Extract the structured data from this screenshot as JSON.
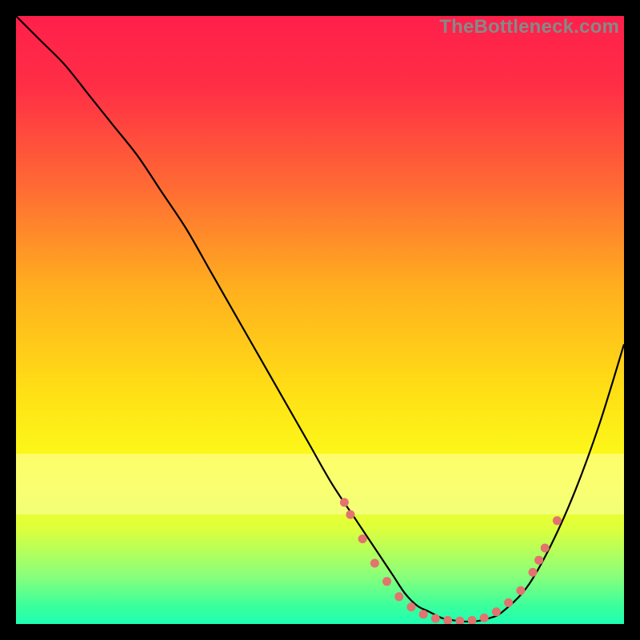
{
  "watermark": "TheBottleneck.com",
  "chart_data": {
    "type": "line",
    "title": "",
    "xlabel": "",
    "ylabel": "",
    "xlim": [
      0,
      100
    ],
    "ylim": [
      0,
      100
    ],
    "gradient_stops": [
      {
        "offset": 0.0,
        "color": "#ff1f4b"
      },
      {
        "offset": 0.12,
        "color": "#ff2f45"
      },
      {
        "offset": 0.28,
        "color": "#ff6a34"
      },
      {
        "offset": 0.45,
        "color": "#ffb01e"
      },
      {
        "offset": 0.62,
        "color": "#ffe015"
      },
      {
        "offset": 0.75,
        "color": "#fbff1a"
      },
      {
        "offset": 0.84,
        "color": "#e0ff3a"
      },
      {
        "offset": 0.92,
        "color": "#8bff7a"
      },
      {
        "offset": 0.97,
        "color": "#3bff9c"
      },
      {
        "offset": 1.0,
        "color": "#1dffb2"
      }
    ],
    "pale_band": {
      "y1": 72,
      "y2": 82,
      "color": "#feffb0",
      "opacity": 0.55
    },
    "series": [
      {
        "name": "curve",
        "x": [
          0,
          4,
          8,
          12,
          16,
          20,
          24,
          28,
          32,
          36,
          40,
          44,
          48,
          52,
          56,
          58,
          60,
          62,
          64,
          66,
          68,
          70,
          72,
          74,
          76,
          78,
          80,
          84,
          88,
          92,
          96,
          100
        ],
        "y": [
          100,
          96,
          92,
          87,
          82,
          77,
          71,
          65,
          58,
          51,
          44,
          37,
          30,
          23,
          17,
          14,
          11,
          8,
          5,
          3,
          2,
          1,
          0.6,
          0.4,
          0.5,
          1,
          2,
          6,
          13,
          22,
          33,
          46
        ]
      }
    ],
    "markers": {
      "name": "dotted-region",
      "color": "#e2736f",
      "radius": 5.5,
      "points": [
        {
          "x": 54,
          "y": 20
        },
        {
          "x": 55,
          "y": 18
        },
        {
          "x": 57,
          "y": 14
        },
        {
          "x": 59,
          "y": 10
        },
        {
          "x": 61,
          "y": 7
        },
        {
          "x": 63,
          "y": 4.5
        },
        {
          "x": 65,
          "y": 2.8
        },
        {
          "x": 67,
          "y": 1.6
        },
        {
          "x": 69,
          "y": 0.9
        },
        {
          "x": 71,
          "y": 0.6
        },
        {
          "x": 73,
          "y": 0.5
        },
        {
          "x": 75,
          "y": 0.6
        },
        {
          "x": 77,
          "y": 1.0
        },
        {
          "x": 79,
          "y": 2.0
        },
        {
          "x": 81,
          "y": 3.5
        },
        {
          "x": 83,
          "y": 5.5
        },
        {
          "x": 85,
          "y": 8.5
        },
        {
          "x": 86,
          "y": 10.5
        },
        {
          "x": 87,
          "y": 12.5
        },
        {
          "x": 89,
          "y": 17
        }
      ]
    }
  }
}
